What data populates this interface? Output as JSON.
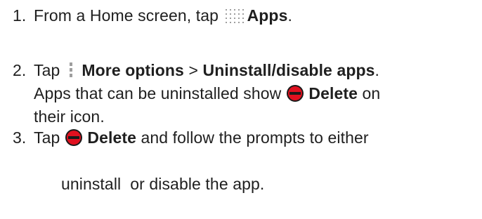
{
  "steps": [
    {
      "number": "1.",
      "parts": {
        "before": "From a Home screen, tap ",
        "bold": "Apps",
        "after": "."
      },
      "icon": "apps-grid-icon"
    },
    {
      "number": "2.",
      "line1": {
        "before": "Tap ",
        "bold1": "More options",
        "sep": " > ",
        "bold2": "Uninstall/disable apps",
        "after": "."
      },
      "line2": {
        "before": "Apps that can be uninstalled show ",
        "bold": "Delete",
        "after": " on"
      },
      "line3": {
        "text": "their icon."
      },
      "icons": [
        "more-options-icon",
        "delete-icon"
      ]
    },
    {
      "number": "3.",
      "line1": {
        "before": "Tap ",
        "bold": "Delete",
        "after": " and follow the prompts to either"
      },
      "line2": {
        "text": "uninstall  or disable the app."
      },
      "icon": "delete-icon"
    }
  ],
  "colors": {
    "text": "#1f1f1f",
    "delete_red": "#e0101f",
    "icon_gray": "#9e9e9e"
  }
}
